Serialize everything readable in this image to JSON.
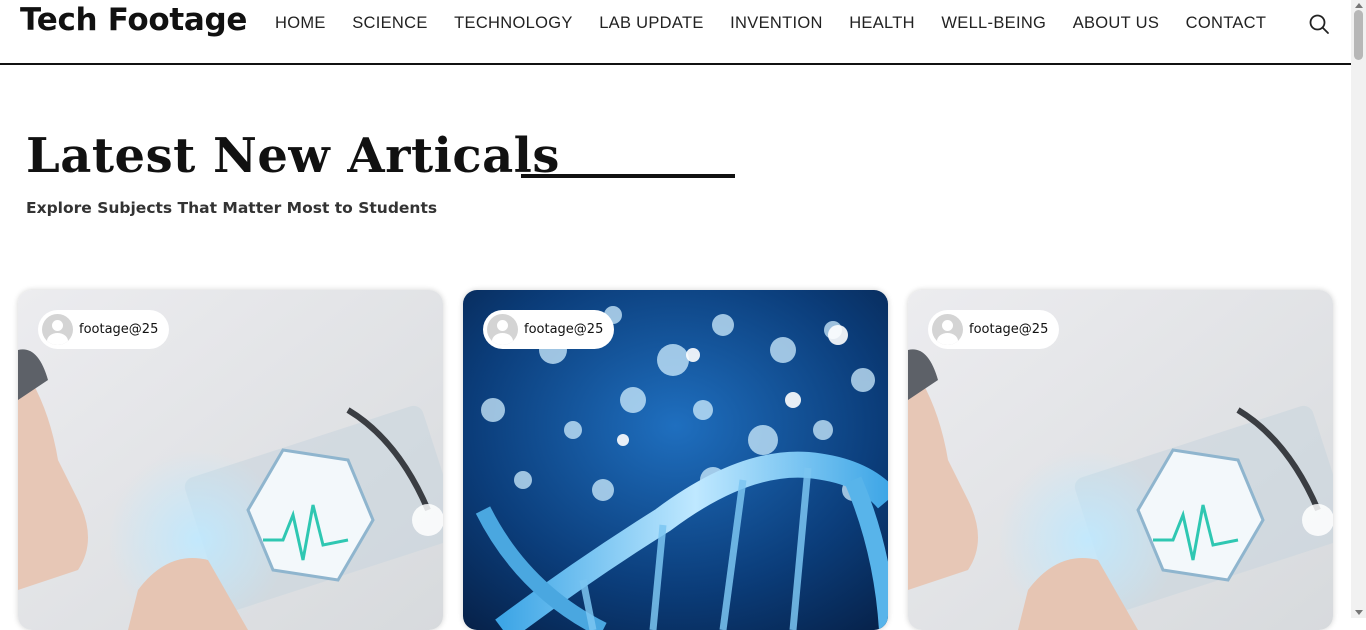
{
  "header": {
    "logo": "Tech Footage",
    "nav": [
      "HOME",
      "SCIENCE",
      "TECHNOLOGY",
      "LAB UPDATE",
      "INVENTION",
      "HEALTH",
      "WELL-BEING",
      "ABOUT US",
      "CONTACT"
    ],
    "search_icon": "search-icon"
  },
  "hero": {
    "title": "Latest New Articals",
    "subtitle": "Explore Subjects That Matter Most to Students"
  },
  "cards": [
    {
      "author": "footage@25",
      "image": "medical-tech-hexagon-heartbeat"
    },
    {
      "author": "footage@25",
      "image": "blue-dna-helix"
    },
    {
      "author": "footage@25",
      "image": "medical-tech-hexagon-heartbeat"
    }
  ],
  "colors": {
    "accent": "#111111",
    "dna_blue": "#1e78c8"
  }
}
